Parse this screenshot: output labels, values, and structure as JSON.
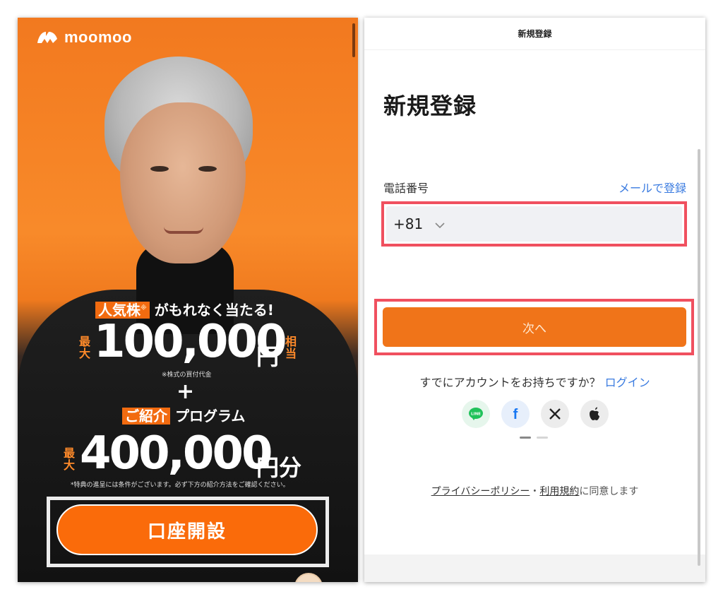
{
  "left": {
    "brand": "moomoo",
    "promo": {
      "tag1": "人気株",
      "tag1_mark": "※",
      "line1_rest": "がもれなく当たる!",
      "prefix_max": "最大",
      "amount1": "100,000",
      "yen1": "円",
      "suffix_equiv": "相当",
      "note1": "※株式の買付代金",
      "plus": "+",
      "tag2": "ご紹介",
      "line3_rest": "プログラム",
      "prefix_max2": "最大",
      "amount2": "400,000",
      "yen2": "円分",
      "note2": "*特典の進呈には条件がございます。必ず下方の紹介方法をご確認ください。"
    },
    "cta_label": "口座開設",
    "colors": {
      "accent": "#fa6b0a",
      "highlight_frame": "#ececec"
    }
  },
  "right": {
    "header_title": "新規登録",
    "page_title": "新規登録",
    "phone_label": "電話番号",
    "email_link": "メールで登録",
    "country_code": "+81",
    "next_label": "次へ",
    "have_account_text": "すでにアカウントをお持ちですか？",
    "login_link": "ログイン",
    "social": [
      {
        "name": "line-icon",
        "label": "LINE"
      },
      {
        "name": "facebook-icon",
        "label": "f"
      },
      {
        "name": "x-icon",
        "label": "X"
      },
      {
        "name": "apple-icon",
        "label": "apple"
      }
    ],
    "policy": {
      "privacy": "プライバシーポリシー",
      "sep": "・",
      "terms": "利用規約",
      "agree": "に同意します"
    },
    "colors": {
      "accent": "#f07419",
      "link": "#3a7be0",
      "highlight_frame": "#f0505f"
    }
  }
}
